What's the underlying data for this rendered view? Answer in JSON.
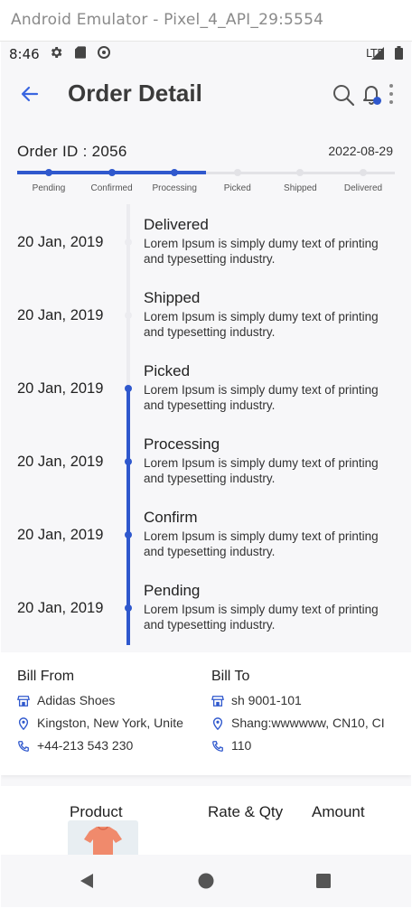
{
  "window": {
    "title": "Android Emulator - Pixel_4_API_29:5554"
  },
  "status_bar": {
    "time": "8:46",
    "network": "LTE"
  },
  "app_bar": {
    "title": "Order Detail"
  },
  "order": {
    "id_label": "Order ID : 2056",
    "date": "2022-08-29",
    "progress_fraction": 0.5,
    "steps": [
      "Pending",
      "Confirmed",
      "Processing",
      "Picked",
      "Shipped",
      "Delivered"
    ],
    "completed_steps": 3
  },
  "timeline": [
    {
      "date": "20 Jan, 2019",
      "status": "Delivered",
      "desc": "Lorem Ipsum is simply dumy text of printing and typesetting industry.",
      "done": false
    },
    {
      "date": "20 Jan, 2019",
      "status": "Shipped",
      "desc": "Lorem Ipsum is simply dumy text of printing and typesetting industry.",
      "done": false
    },
    {
      "date": "20 Jan, 2019",
      "status": "Picked",
      "desc": "Lorem Ipsum is simply dumy text of printing and typesetting industry.",
      "done": true
    },
    {
      "date": "20 Jan, 2019",
      "status": "Processing",
      "desc": "Lorem Ipsum is simply dumy text of printing and typesetting industry.",
      "done": true
    },
    {
      "date": "20 Jan, 2019",
      "status": "Confirm",
      "desc": "Lorem Ipsum is simply dumy text of printing and typesetting industry.",
      "done": true
    },
    {
      "date": "20 Jan, 2019",
      "status": "Pending",
      "desc": "Lorem Ipsum is simply dumy text of printing and typesetting industry.",
      "done": true
    }
  ],
  "bill_from": {
    "heading": "Bill From",
    "name": "Adidas Shoes",
    "address": "Kingston, New York, Unite",
    "phone": "+44-213 543 230"
  },
  "bill_to": {
    "heading": "Bill To",
    "name": "sh 9001-101",
    "address": "Shang:wwwwww, CN10, CI",
    "phone": "110"
  },
  "product_table": {
    "col_product": "Product",
    "col_rate_qty": "Rate & Qty",
    "col_amount": "Amount"
  },
  "colors": {
    "accent": "#2f58cd",
    "inactive": "#e2e2e6",
    "background": "#f7f7f9"
  },
  "icons": [
    "back-arrow-icon",
    "search-icon",
    "bell-icon",
    "more-vert-icon",
    "store-icon",
    "location-pin-icon",
    "phone-icon",
    "tshirt-icon",
    "nav-back-icon",
    "nav-home-icon",
    "nav-recents-icon"
  ]
}
